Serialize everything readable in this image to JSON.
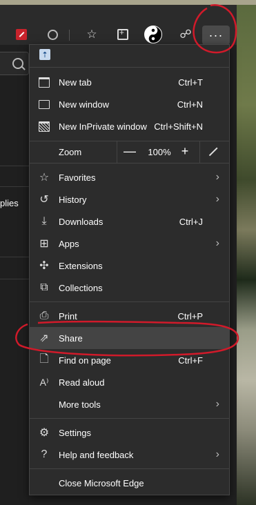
{
  "menu": {
    "items": [
      {
        "label": "New tab",
        "shortcut": "Ctrl+T"
      },
      {
        "label": "New window",
        "shortcut": "Ctrl+N"
      },
      {
        "label": "New InPrivate window",
        "shortcut": "Ctrl+Shift+N"
      }
    ],
    "zoom": {
      "label": "Zoom",
      "minus": "—",
      "value": "100%",
      "plus": "+"
    },
    "group2": [
      {
        "label": "Favorites"
      },
      {
        "label": "History"
      },
      {
        "label": "Downloads",
        "shortcut": "Ctrl+J"
      },
      {
        "label": "Apps"
      },
      {
        "label": "Extensions"
      },
      {
        "label": "Collections"
      }
    ],
    "group3": [
      {
        "label": "Print",
        "shortcut": "Ctrl+P"
      },
      {
        "label": "Share"
      },
      {
        "label": "Find on page",
        "shortcut": "Ctrl+F"
      },
      {
        "label": "Read aloud"
      },
      {
        "label": "More tools"
      }
    ],
    "group4": [
      {
        "label": "Settings"
      },
      {
        "label": "Help and feedback"
      }
    ],
    "close": {
      "label": "Close Microsoft Edge"
    }
  },
  "toolbar": {
    "more_label": "···"
  },
  "page": {
    "left_snippet": "plies"
  },
  "colors": {
    "annotation": "#d11a2a",
    "menu_bg": "#2c2c2c",
    "highlight": "#444444"
  }
}
